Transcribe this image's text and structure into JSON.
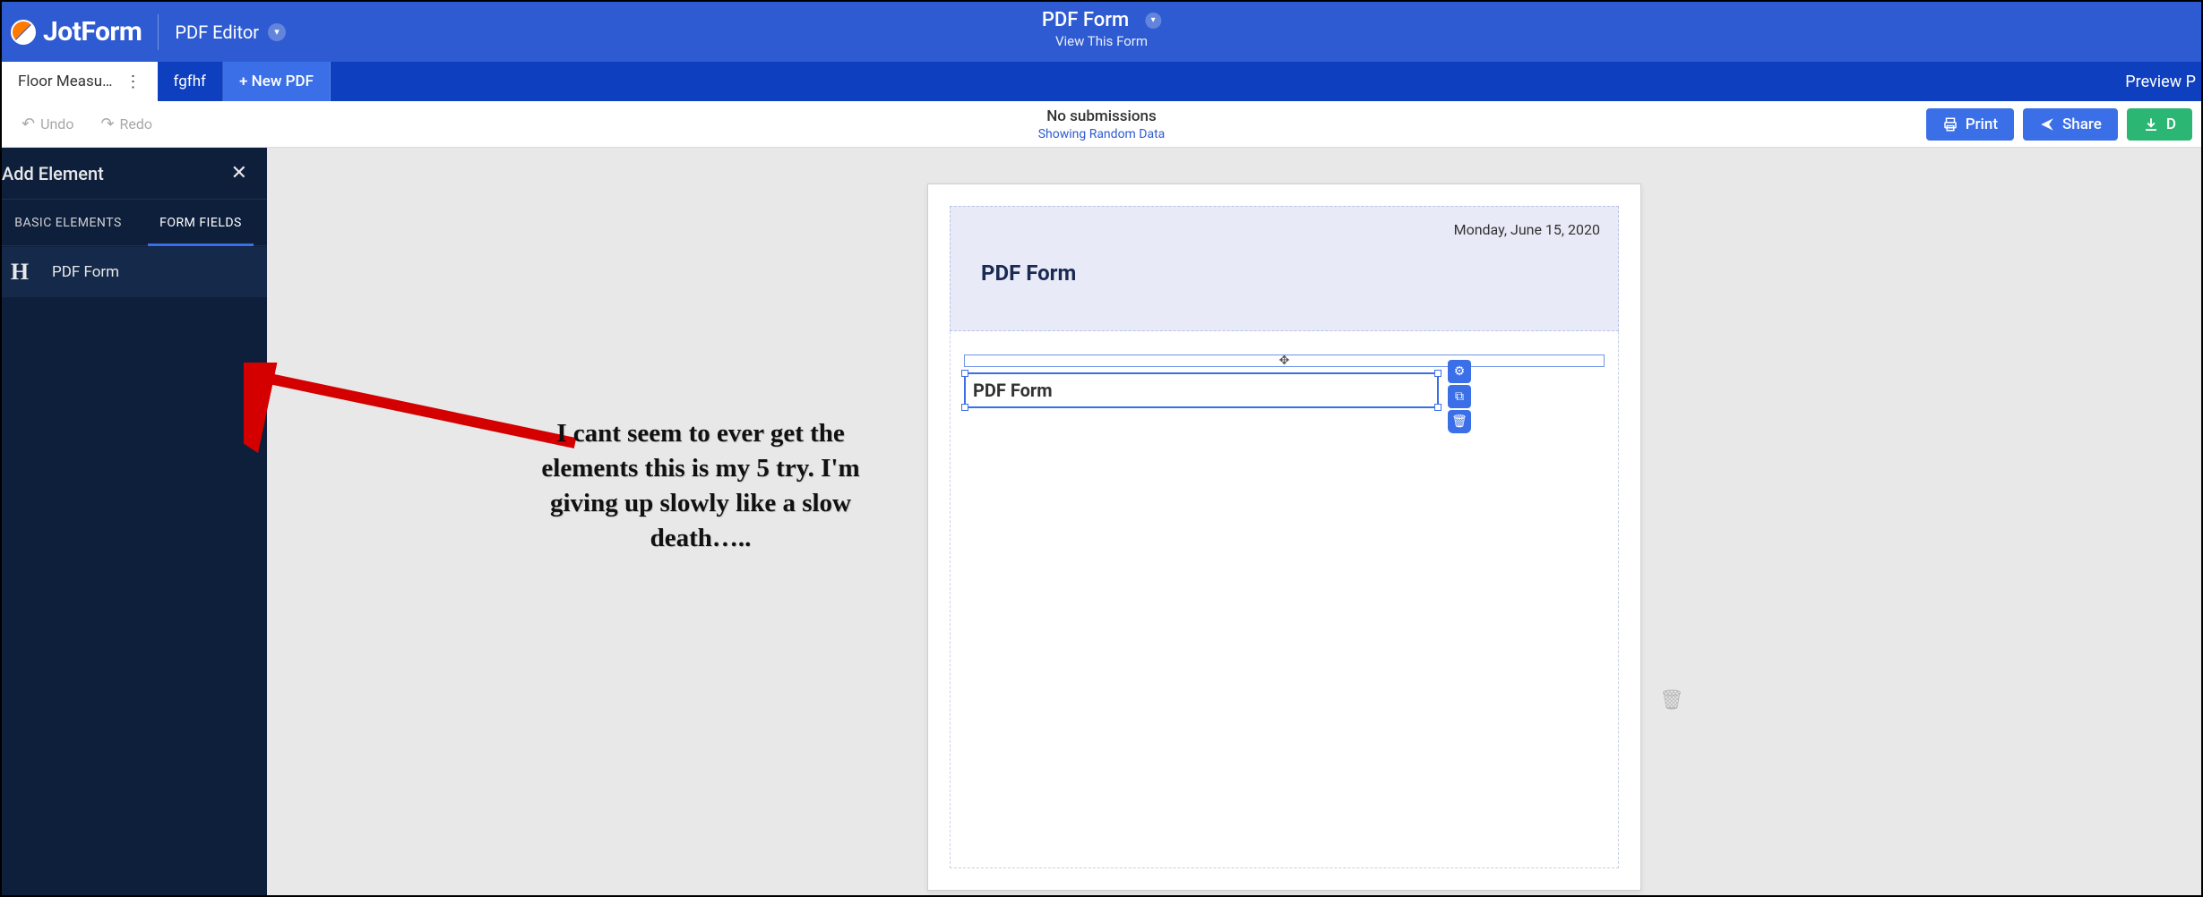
{
  "brand": {
    "name": "JotForm",
    "product": "PDF Editor"
  },
  "header": {
    "doc_title": "PDF Form",
    "view_link": "View This Form"
  },
  "tabs": {
    "items": [
      {
        "label": "Floor Measu…",
        "active": true
      },
      {
        "label": "fgfhf",
        "active": false
      }
    ],
    "new_pdf": "+ New PDF",
    "preview": "Preview P"
  },
  "toolbar": {
    "undo": "Undo",
    "redo": "Redo",
    "no_submissions": "No submissions",
    "random_data": "Showing Random Data",
    "print": "Print",
    "share": "Share",
    "download": "D"
  },
  "sidepanel": {
    "title": "Add Element",
    "tabs": {
      "basic": "BASIC ELEMENTS",
      "fields": "FORM FIELDS"
    },
    "items": [
      {
        "icon": "H",
        "label": "PDF Form"
      }
    ]
  },
  "page": {
    "date": "Monday, June 15, 2020",
    "header_title": "PDF Form",
    "selected_text": "PDF Form"
  },
  "annotation": {
    "text": "I cant seem to ever get the elements this is my 5 try. I'm giving up slowly like a slow death….."
  },
  "colors": {
    "blue_top": "#2E5BD1",
    "blue_dark": "#0E3FBF",
    "blue_btn": "#3B6FE8",
    "panel": "#0E1F3C",
    "green": "#2BB673"
  }
}
